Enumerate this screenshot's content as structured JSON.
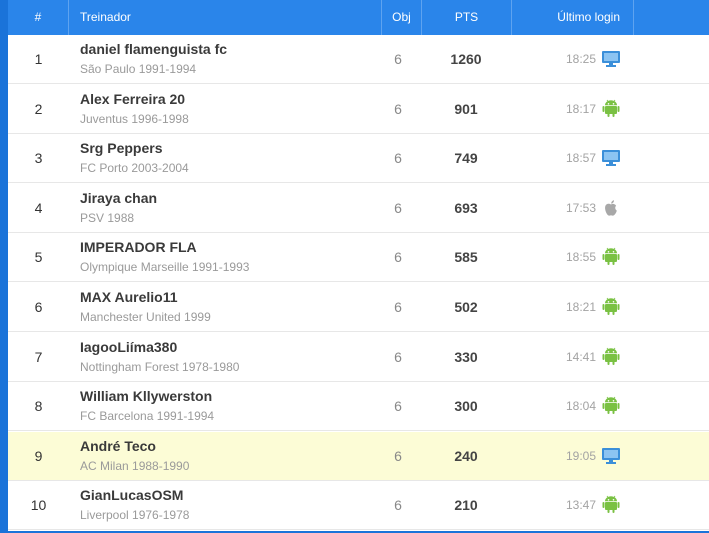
{
  "table": {
    "headers": {
      "rank": "#",
      "coach": "Treinador",
      "obj": "Obj",
      "pts": "PTS",
      "last_login": "Último login"
    },
    "rows": [
      {
        "rank": "1",
        "name": "daniel flamenguista fc",
        "team": "São Paulo 1991-1994",
        "obj": "6",
        "pts": "1260",
        "time": "18:25",
        "device": "desktop-icon",
        "highlight": false
      },
      {
        "rank": "2",
        "name": "Alex Ferreira 20",
        "team": "Juventus 1996-1998",
        "obj": "6",
        "pts": "901",
        "time": "18:17",
        "device": "android-icon",
        "highlight": false
      },
      {
        "rank": "3",
        "name": "Srg Peppers",
        "team": "FC Porto 2003-2004",
        "obj": "6",
        "pts": "749",
        "time": "18:57",
        "device": "desktop-icon",
        "highlight": false
      },
      {
        "rank": "4",
        "name": "Jiraya chan",
        "team": "PSV 1988",
        "obj": "6",
        "pts": "693",
        "time": "17:53",
        "device": "apple-icon",
        "highlight": false
      },
      {
        "rank": "5",
        "name": "IMPERADOR FLA",
        "team": "Olympique Marseille 1991-1993",
        "obj": "6",
        "pts": "585",
        "time": "18:55",
        "device": "android-icon",
        "highlight": false
      },
      {
        "rank": "6",
        "name": "MAX Aurelio11",
        "team": "Manchester United 1999",
        "obj": "6",
        "pts": "502",
        "time": "18:21",
        "device": "android-icon",
        "highlight": false
      },
      {
        "rank": "7",
        "name": "IagooLiíma380",
        "team": "Nottingham Forest 1978-1980",
        "obj": "6",
        "pts": "330",
        "time": "14:41",
        "device": "android-icon",
        "highlight": false
      },
      {
        "rank": "8",
        "name": "William Kllywerston",
        "team": "FC Barcelona 1991-1994",
        "obj": "6",
        "pts": "300",
        "time": "18:04",
        "device": "android-icon",
        "highlight": false
      },
      {
        "rank": "9",
        "name": "André Teco",
        "team": "AC Milan 1988-1990",
        "obj": "6",
        "pts": "240",
        "time": "19:05",
        "device": "desktop-icon",
        "highlight": true
      },
      {
        "rank": "10",
        "name": "GianLucasOSM",
        "team": "Liverpool 1976-1978",
        "obj": "6",
        "pts": "210",
        "time": "13:47",
        "device": "android-icon",
        "highlight": false
      }
    ]
  },
  "colors": {
    "header_bg": "#2a85ea",
    "frame": "#1a73d9",
    "highlight_row": "#fcfcd6",
    "android": "#7ac143",
    "desktop": "#3b8fd9",
    "apple": "#a8a8a8"
  }
}
